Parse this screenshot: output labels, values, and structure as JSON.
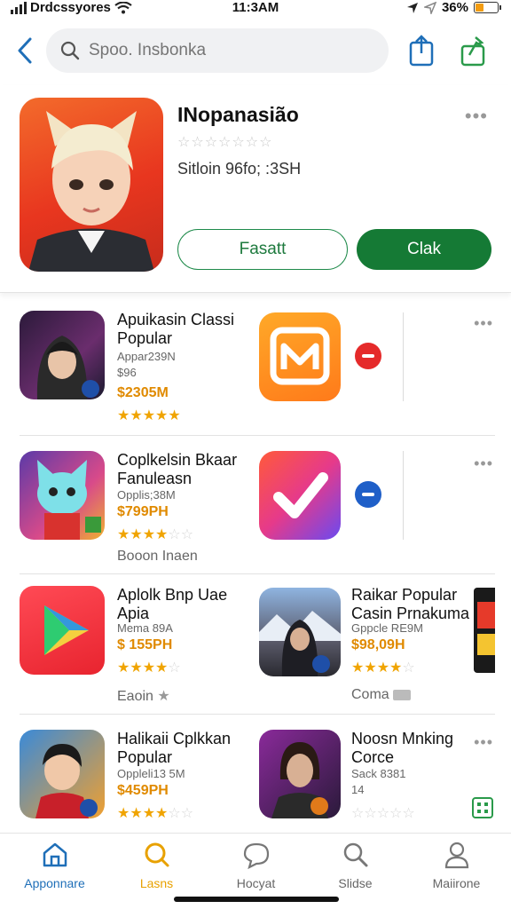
{
  "status": {
    "carrier": "Drdcssyores",
    "time": "11:3AM",
    "battery": "36%",
    "battery_level": 0.36
  },
  "search": {
    "placeholder": "Spoo. Insbonka"
  },
  "featured": {
    "title": "INopanasião",
    "stars": "☆☆☆☆☆☆☆",
    "subtitle": "Sitloin 96fo; :3SH",
    "more": "•••",
    "button_outline": "Fasatt",
    "button_solid": "Clak"
  },
  "apps": [
    {
      "name": "Apuikasin Classi Popular",
      "dev": "Appar239N",
      "size": "$96",
      "price": "$2305M",
      "stars": "★★★★★",
      "stars_off": ""
    },
    {
      "name": "Coplkelsin Bkaar Fanuleasn",
      "dev": "Opplis;38M",
      "price": "$799PH",
      "stars": "★★★★",
      "stars_off": "☆☆",
      "extra": "Booon Inaen"
    },
    {
      "name": "Aplolk Bnp Uae Apia",
      "dev": "Mema 89A",
      "price": "$ 155PH",
      "stars": "★★★★",
      "stars_off": "☆",
      "extra": "Eaoin"
    },
    {
      "name": "Raikar Popular Casin Prnakuma",
      "dev": "Gppcle RE9M",
      "price": "$98,09H",
      "stars": "★★★★",
      "stars_off": "☆",
      "extra": "Coma"
    },
    {
      "name": "Halikaii Cplkkan Popular",
      "dev": "Oppleli13 5M",
      "price": "$459PH",
      "stars": "★★★★",
      "stars_off": "☆☆",
      "extra": ""
    },
    {
      "name": "Noosn Mnking Corce",
      "dev": "Sack 8381",
      "price": "14",
      "stars": "",
      "stars_off": "☆☆☆☆☆",
      "extra": ""
    }
  ],
  "more_label": "•••",
  "tabs": [
    {
      "label": "Apponnare",
      "color": "#1f6fb8"
    },
    {
      "label": "Lasns",
      "color": "#e8a100"
    },
    {
      "label": "Hocyat",
      "color": "#666666"
    },
    {
      "label": "Slidse",
      "color": "#666666"
    },
    {
      "label": "Maiirone",
      "color": "#666666"
    }
  ],
  "colors": {
    "accent_green": "#157a35",
    "accent_blue": "#1f6fb8",
    "price_orange": "#e08a00",
    "star_gold": "#f0a400"
  },
  "icons": [
    "back-chevron-icon",
    "search-icon",
    "share-icon",
    "share-alt-icon",
    "more-icon",
    "remove-icon",
    "home-icon",
    "search-tab-icon",
    "chat-icon",
    "magnifier-icon",
    "person-icon"
  ]
}
